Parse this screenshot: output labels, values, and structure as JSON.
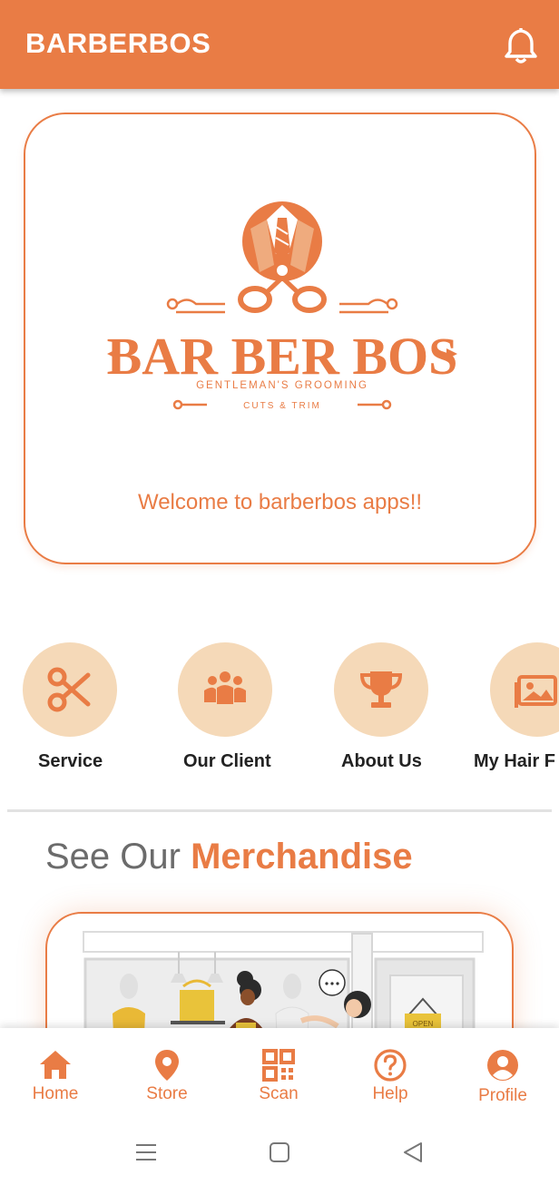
{
  "app": {
    "title": "BARBERBOS",
    "accent_color": "#E97C45",
    "light_accent_color": "#F5D9B8"
  },
  "header": {
    "notification_icon": "bell-icon"
  },
  "hero": {
    "logo_text": "BAR BER BOS",
    "logo_tagline": "GENTLEMAN'S GROOMING",
    "logo_subtagline": "CUTS & TRIM",
    "welcome_text": "Welcome to barberbos apps!!"
  },
  "categories": [
    {
      "label": "Service",
      "icon": "scissors-icon"
    },
    {
      "label": "Our Client",
      "icon": "group-icon"
    },
    {
      "label": "About Us",
      "icon": "trophy-icon"
    },
    {
      "label": "My Hair F",
      "icon": "gallery-icon"
    }
  ],
  "merchandise": {
    "title_prefix": "See Our",
    "title_accent": "Merchandise",
    "sign_text": "OPEN"
  },
  "bottom_nav": [
    {
      "label": "Home",
      "icon": "home-icon"
    },
    {
      "label": "Store",
      "icon": "location-pin-icon"
    },
    {
      "label": "Scan",
      "icon": "qr-code-icon"
    },
    {
      "label": "Help",
      "icon": "help-icon"
    },
    {
      "label": "Profile",
      "icon": "profile-icon"
    }
  ],
  "system_nav": [
    {
      "icon": "recents-icon"
    },
    {
      "icon": "home-square-icon"
    },
    {
      "icon": "back-icon"
    }
  ]
}
